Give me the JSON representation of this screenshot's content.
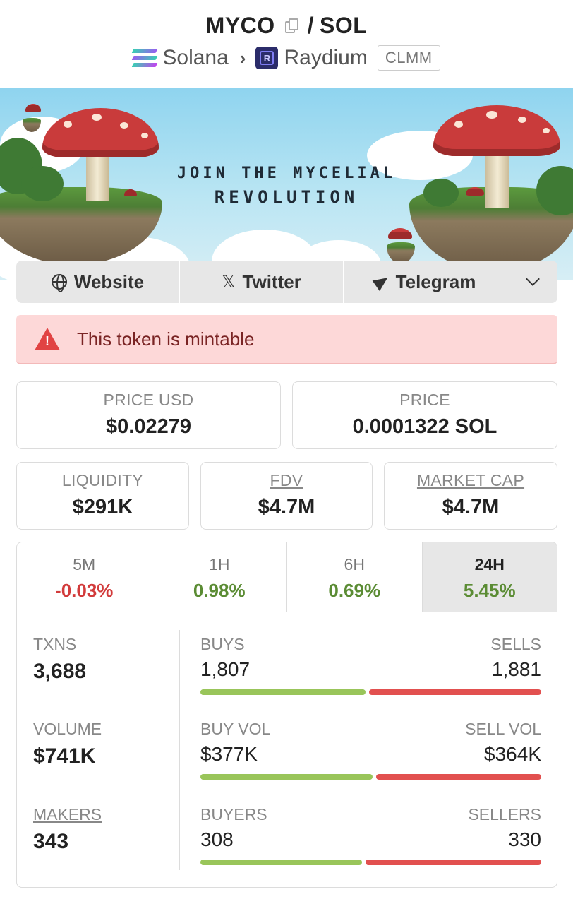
{
  "header": {
    "base": "MYCO",
    "separator": "/",
    "quote": "SOL",
    "chain": "Solana",
    "dex": "Raydium",
    "pool_type": "CLMM"
  },
  "banner": {
    "line1": "JOIN THE MYCELIAL",
    "line2": "REVOLUTION"
  },
  "links": {
    "website": "Website",
    "twitter": "Twitter",
    "telegram": "Telegram"
  },
  "warning": {
    "text": "This token is mintable"
  },
  "stats": {
    "price_usd_label": "PRICE USD",
    "price_usd": "$0.02279",
    "price_label": "PRICE",
    "price": "0.0001322 SOL",
    "liquidity_label": "LIQUIDITY",
    "liquidity": "$291K",
    "fdv_label": "FDV",
    "fdv": "$4.7M",
    "mcap_label": "MARKET CAP",
    "mcap": "$4.7M"
  },
  "timeframes": [
    {
      "label": "5M",
      "change": "-0.03%",
      "sign": "neg",
      "active": false
    },
    {
      "label": "1H",
      "change": "0.98%",
      "sign": "pos",
      "active": false
    },
    {
      "label": "6H",
      "change": "0.69%",
      "sign": "pos",
      "active": false
    },
    {
      "label": "24H",
      "change": "5.45%",
      "sign": "pos",
      "active": true
    }
  ],
  "metrics": {
    "txns_label": "TXNS",
    "txns": "3,688",
    "volume_label": "VOLUME",
    "volume": "$741K",
    "makers_label": "MAKERS",
    "makers": "343",
    "buys_label": "BUYS",
    "buys": "1,807",
    "sells_label": "SELLS",
    "sells": "1,881",
    "buy_fraction": 0.49,
    "buy_vol_label": "BUY VOL",
    "buy_vol": "$377K",
    "sell_vol_label": "SELL VOL",
    "sell_vol": "$364K",
    "buy_vol_fraction": 0.51,
    "buyers_label": "BUYERS",
    "buyers": "308",
    "sellers_label": "SELLERS",
    "sellers": "330",
    "buyers_fraction": 0.48
  },
  "colors": {
    "positive": "#5b8c34",
    "negative": "#d23b3b",
    "buy_bar": "#99c55a",
    "sell_bar": "#e2504f"
  }
}
